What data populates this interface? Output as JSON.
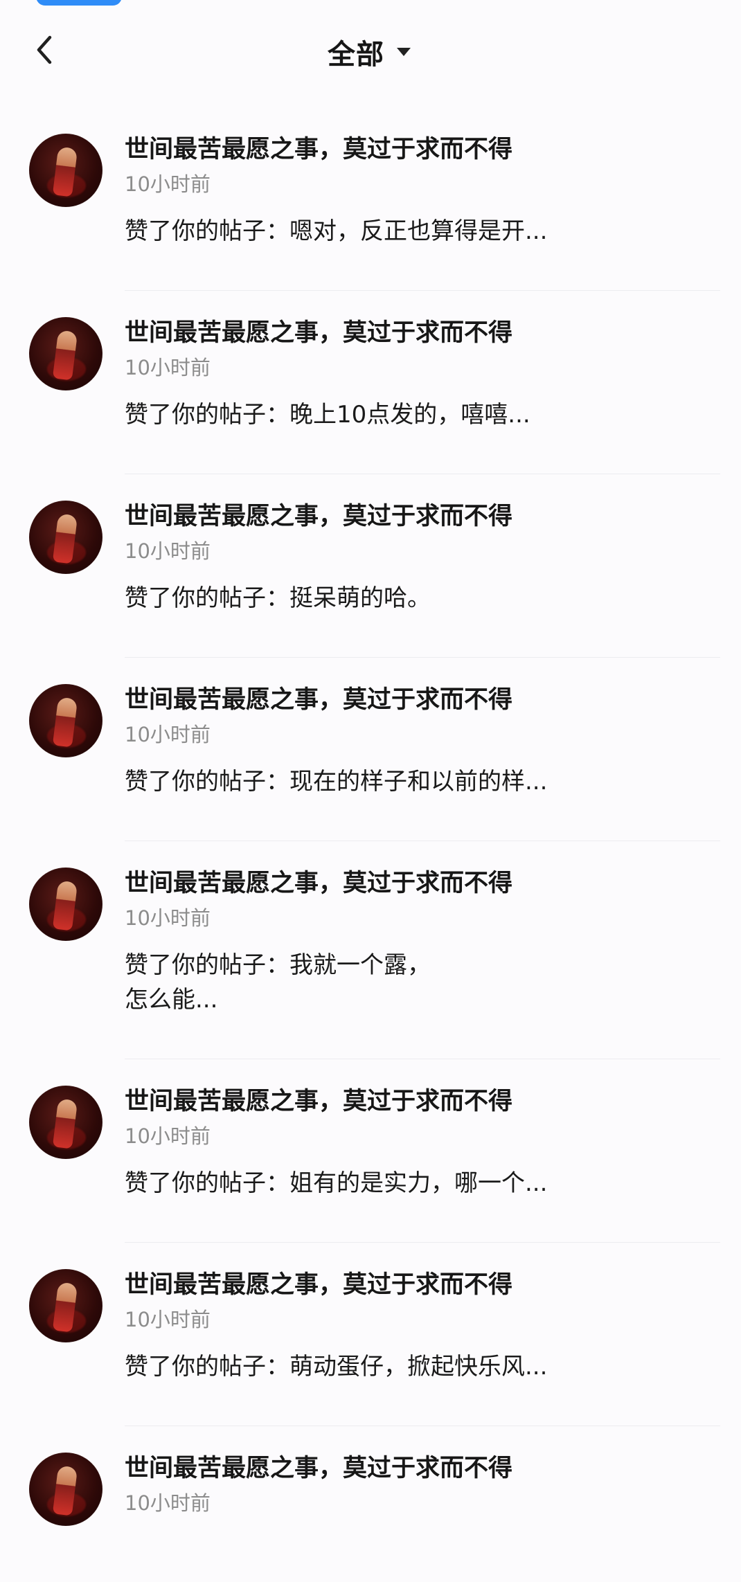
{
  "header": {
    "title": "全部"
  },
  "notifications": [
    {
      "name": "世间最苦最愿之事，莫过于求而不得",
      "time": "10小时前",
      "message": "赞了你的帖子：嗯对，反正也算得是开..."
    },
    {
      "name": "世间最苦最愿之事，莫过于求而不得",
      "time": "10小时前",
      "message": "赞了你的帖子：晚上10点发的，嘻嘻..."
    },
    {
      "name": "世间最苦最愿之事，莫过于求而不得",
      "time": "10小时前",
      "message": "赞了你的帖子：挺呆萌的哈。"
    },
    {
      "name": "世间最苦最愿之事，莫过于求而不得",
      "time": "10小时前",
      "message": "赞了你的帖子：现在的样子和以前的样..."
    },
    {
      "name": "世间最苦最愿之事，莫过于求而不得",
      "time": "10小时前",
      "message": "赞了你的帖子：我就一个露，\n怎么能..."
    },
    {
      "name": "世间最苦最愿之事，莫过于求而不得",
      "time": "10小时前",
      "message": "赞了你的帖子：姐有的是实力，哪一个..."
    },
    {
      "name": "世间最苦最愿之事，莫过于求而不得",
      "time": "10小时前",
      "message": "赞了你的帖子：萌动蛋仔，掀起快乐风..."
    },
    {
      "name": "世间最苦最愿之事，莫过于求而不得",
      "time": "10小时前"
    }
  ],
  "colors": {
    "background": "#fcfbfd",
    "accent": "#2f8cf7",
    "primary_text": "#171717",
    "secondary_text": "#8c8c8c",
    "divider": "#ececf0"
  }
}
